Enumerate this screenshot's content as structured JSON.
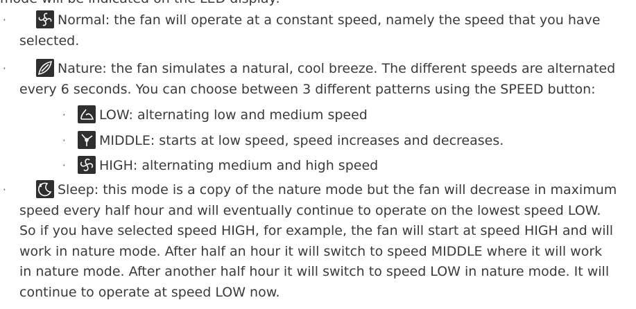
{
  "intro": "mode will be indicated on the LED display:",
  "modes": {
    "normal": {
      "icon": "fan-normal-icon",
      "line1": "Normal: the fan will operate at a constant speed, namely the speed that you have",
      "line2": "selected."
    },
    "nature": {
      "icon": "leaf-nature-icon",
      "line1": "Nature: the fan simulates a natural, cool breeze. The different speeds are alternated",
      "line2": "every 6 seconds. You can choose between 3 different patterns using the SPEED button:",
      "patterns": [
        {
          "icon": "speed-low-icon",
          "text": "LOW: alternating low and medium speed"
        },
        {
          "icon": "speed-middle-icon",
          "text": "MIDDLE: starts at low speed, speed increases and decreases."
        },
        {
          "icon": "speed-high-icon",
          "text": "HIGH: alternating medium and high speed"
        }
      ]
    },
    "sleep": {
      "icon": "sleep-mode-icon",
      "lines": [
        "Sleep: this mode is a copy of the nature mode but the fan will decrease in maximum",
        "speed every half hour and will eventually continue to operate on the lowest speed LOW.",
        "So if you have selected speed HIGH, for example, the fan will start at speed HIGH and will",
        "work in nature mode. After half an hour it will switch to speed MIDDLE where it will work",
        "in nature mode. After another half hour it will switch to speed LOW in nature mode. It will",
        "continue to operate at speed LOW now."
      ]
    }
  },
  "colors": {
    "text": "#3a3a3a",
    "icon_bg": "#2f2f2f",
    "icon_fg": "#ffffff"
  }
}
